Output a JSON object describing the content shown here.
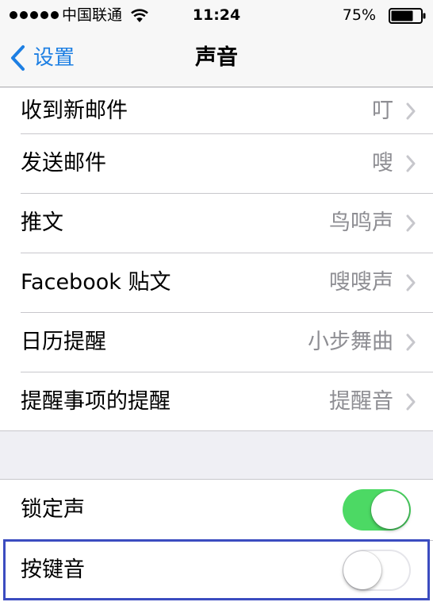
{
  "status_bar": {
    "carrier": "中国联通",
    "time": "11:24",
    "battery_percent": "75%",
    "battery_level": 0.75
  },
  "nav": {
    "back_label": "设置",
    "title": "声音"
  },
  "sounds": [
    {
      "label": "收到新邮件",
      "value": "叮"
    },
    {
      "label": "发送邮件",
      "value": "嗖"
    },
    {
      "label": "推文",
      "value": "鸟鸣声"
    },
    {
      "label": "Facebook 贴文",
      "value": "嗖嗖声"
    },
    {
      "label": "日历提醒",
      "value": "小步舞曲"
    },
    {
      "label": "提醒事项的提醒",
      "value": "提醒音"
    }
  ],
  "toggles": [
    {
      "label": "锁定声",
      "on": true
    },
    {
      "label": "按键音",
      "on": false
    }
  ],
  "colors": {
    "accent": "#1d7fe3",
    "switch_on": "#4cd964",
    "highlight": "#3b4cc0"
  }
}
